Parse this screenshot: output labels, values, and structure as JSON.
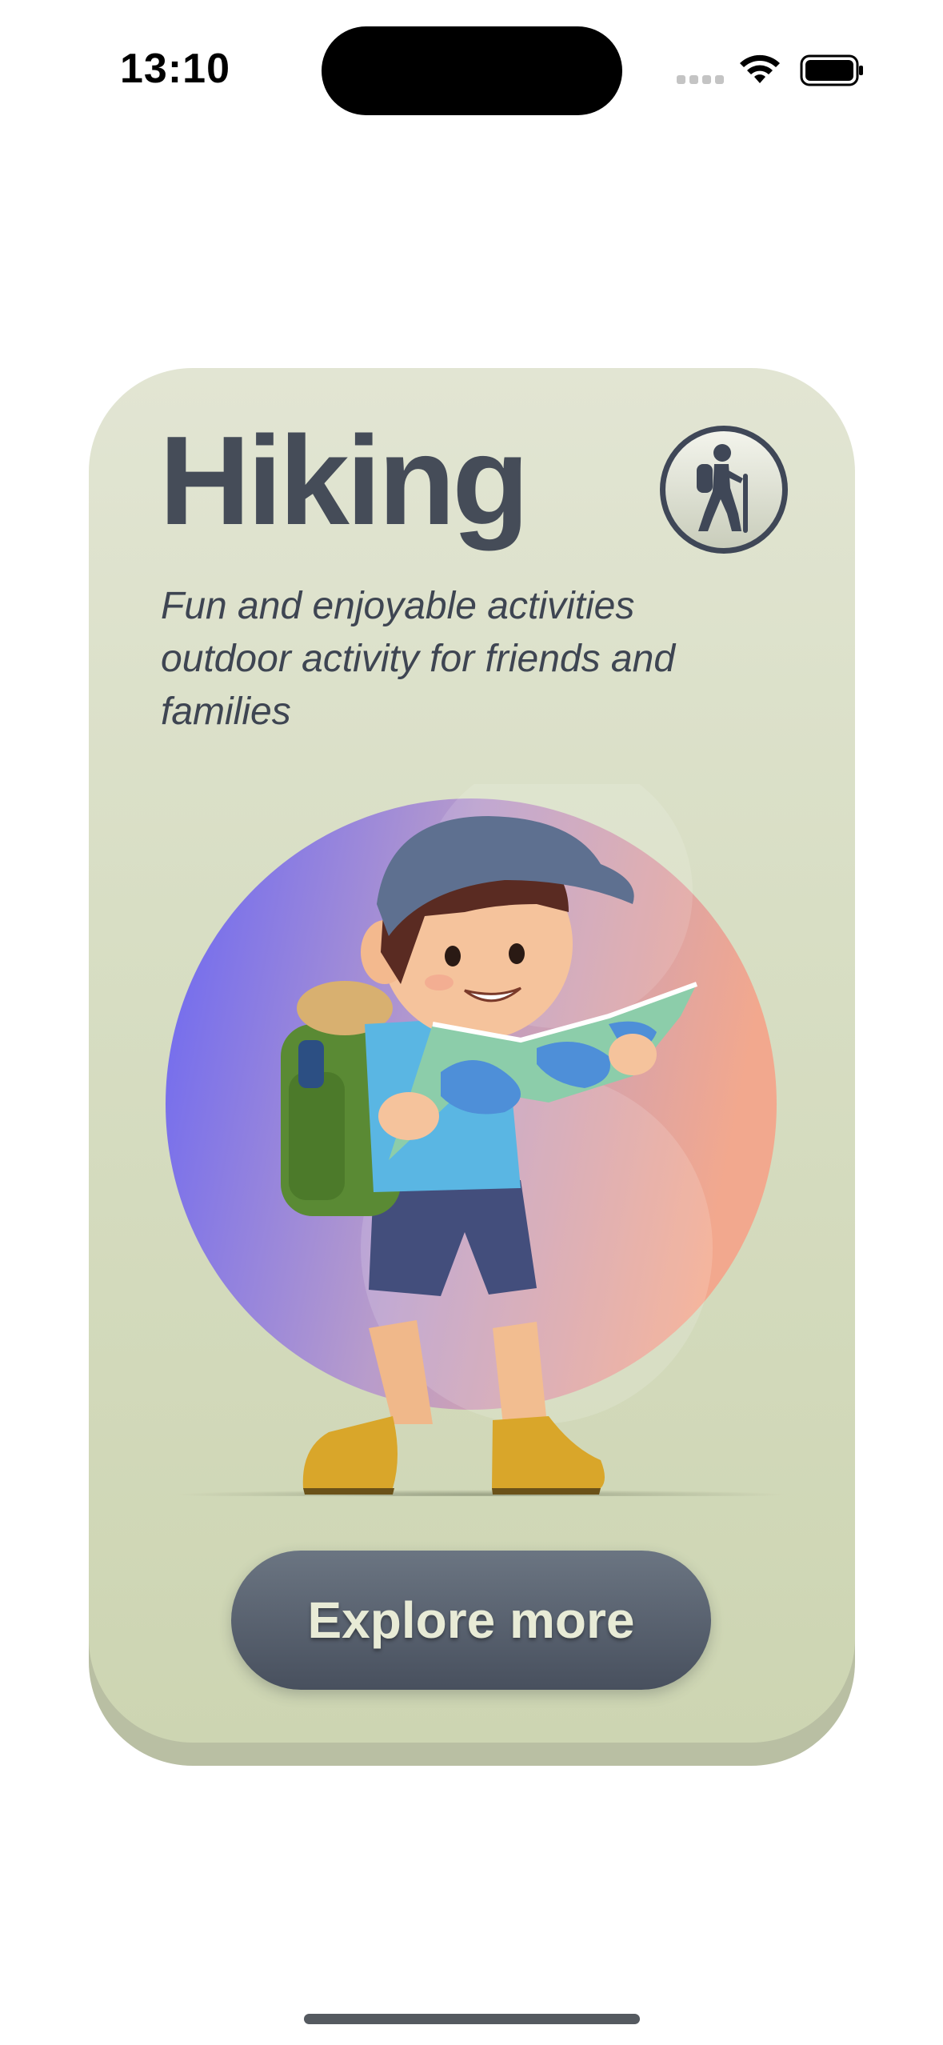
{
  "status_bar": {
    "time": "13:10"
  },
  "card": {
    "title": "Hiking",
    "subtitle": "Fun and enjoyable activities outdoor activity for friends and families",
    "badge_icon": "hiker-icon",
    "illustration": "boy-hiker-with-map-illustration",
    "button_label": "Explore more"
  },
  "colors": {
    "card_bg": "#d8dec4",
    "title": "#454c58",
    "button": "#5a6370",
    "button_text": "#e8ebd6",
    "circle_gradient_start": "#6b67f2",
    "circle_gradient_end": "#f0a98f"
  }
}
